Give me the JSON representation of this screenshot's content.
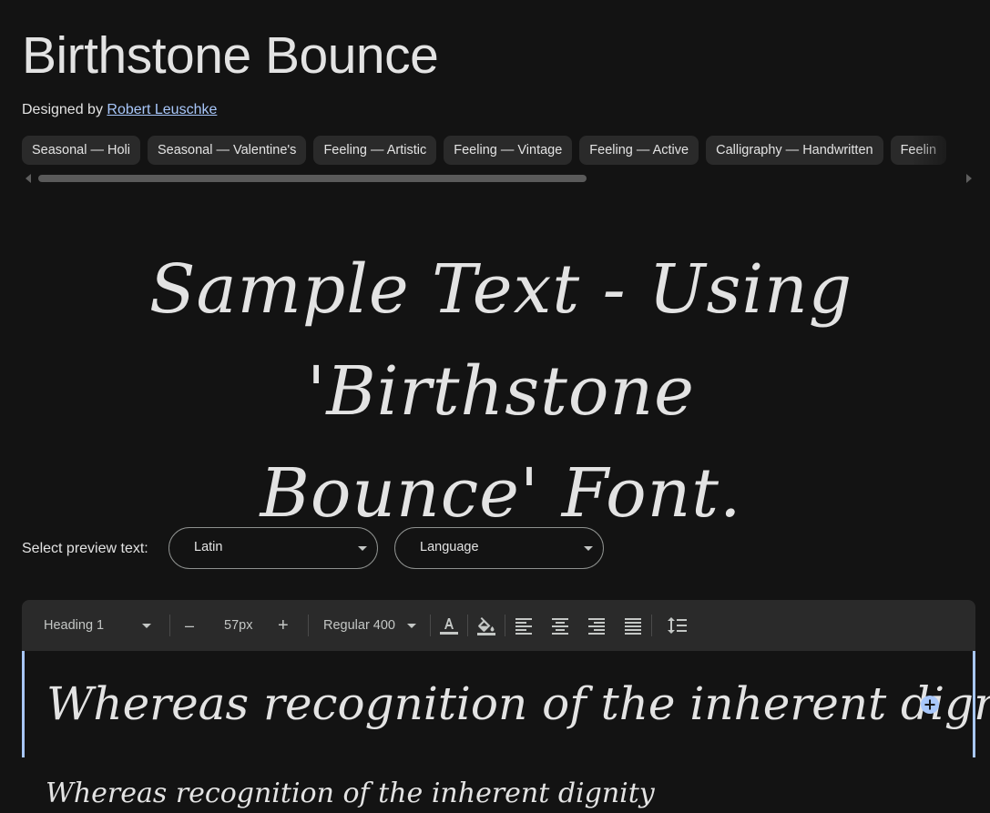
{
  "title": "Birthstone Bounce",
  "designer": {
    "prefix": "Designed by",
    "name": "Robert Leuschke"
  },
  "tags": [
    "Seasonal — Holi",
    "Seasonal — Valentine's",
    "Feeling — Artistic",
    "Feeling — Vintage",
    "Feeling — Active",
    "Calligraphy — Handwritten",
    "Feelin"
  ],
  "hero": {
    "line1": "Sample Text - Using 'Birthstone",
    "line2": "Bounce' Font."
  },
  "preview": {
    "label": "Select preview text:",
    "script_value": "Latin",
    "language_value": "Language"
  },
  "toolbar": {
    "style_value": "Heading 1",
    "decrease_label": "–",
    "size_value": "57px",
    "increase_label": "+",
    "weight_value": "Regular 400"
  },
  "editor": {
    "line1": "Whereas recognition of the inherent dignity",
    "line2": "Whereas recognition of the inherent dignity"
  },
  "colors": {
    "background": "#131313",
    "surface": "#2a2a2a",
    "accent": "#a8c7fa",
    "text": "#e3e3e3"
  },
  "icons": {
    "text_color": "text-color-icon",
    "fill_color": "fill-color-icon",
    "align_left": "align-left-icon",
    "align_center": "align-center-icon",
    "align_right": "align-right-icon",
    "align_justify": "align-justify-icon",
    "line_height": "line-height-icon",
    "add": "add-circle-icon"
  }
}
